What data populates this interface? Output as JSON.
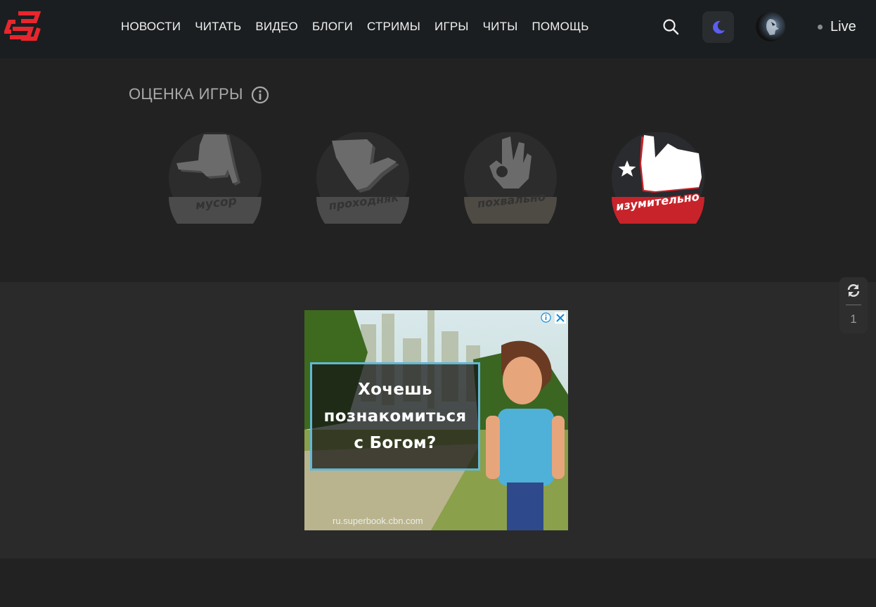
{
  "header": {
    "nav": [
      "НОВОСТИ",
      "ЧИТАТЬ",
      "ВИДЕО",
      "БЛОГИ",
      "СТРИМЫ",
      "ИГРЫ",
      "ЧИТЫ",
      "ПОМОЩЬ"
    ],
    "live_label": "Live",
    "logo_icon": "site-logo-icon",
    "accent_color": "#e8262e",
    "theme_icon_color": "#5b5ef0"
  },
  "rating": {
    "title": "ОЦЕНКА ИГРЫ",
    "options": [
      {
        "label": "мусор",
        "icon": "thumbs-down-icon",
        "active": false
      },
      {
        "label": "проходняк",
        "icon": "thumb-sideways-icon",
        "active": false
      },
      {
        "label": "похвально",
        "icon": "ok-hand-icon",
        "active": false
      },
      {
        "label": "изумительно",
        "icon": "thumbs-up-star-icon",
        "active": true
      }
    ]
  },
  "ad": {
    "lines": [
      "Хочешь",
      "познакомиться",
      "с Богом?"
    ],
    "url": "ru.superbook.cbn.com"
  },
  "side_widget": {
    "count": "1"
  }
}
